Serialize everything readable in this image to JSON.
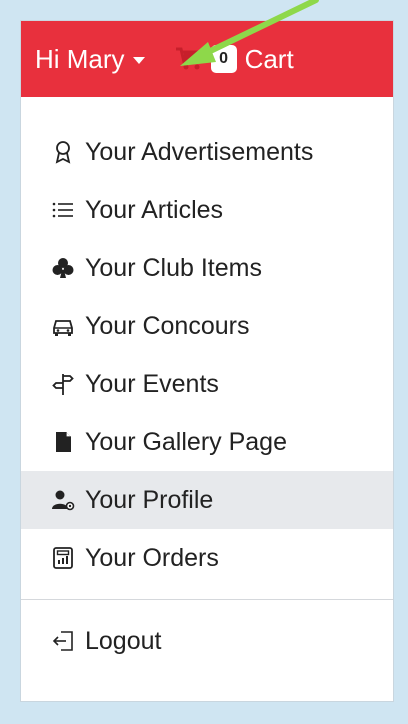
{
  "header": {
    "greeting": "Hi Mary",
    "cart_count": "0",
    "cart_label": "Cart",
    "bar_color": "#e8303d"
  },
  "menu": {
    "items": [
      {
        "label": "Your Advertisements",
        "icon": "award-icon"
      },
      {
        "label": "Your Articles",
        "icon": "list-icon"
      },
      {
        "label": "Your Club Items",
        "icon": "club-icon"
      },
      {
        "label": "Your Concours",
        "icon": "car-icon"
      },
      {
        "label": "Your Events",
        "icon": "signpost-icon"
      },
      {
        "label": "Your Gallery Page",
        "icon": "file-icon"
      },
      {
        "label": "Your Profile",
        "icon": "user-gear-icon",
        "active": true
      },
      {
        "label": "Your Orders",
        "icon": "receipt-icon"
      }
    ],
    "logout_label": "Logout"
  },
  "annotation": {
    "arrow_color": "#8ed84a"
  }
}
